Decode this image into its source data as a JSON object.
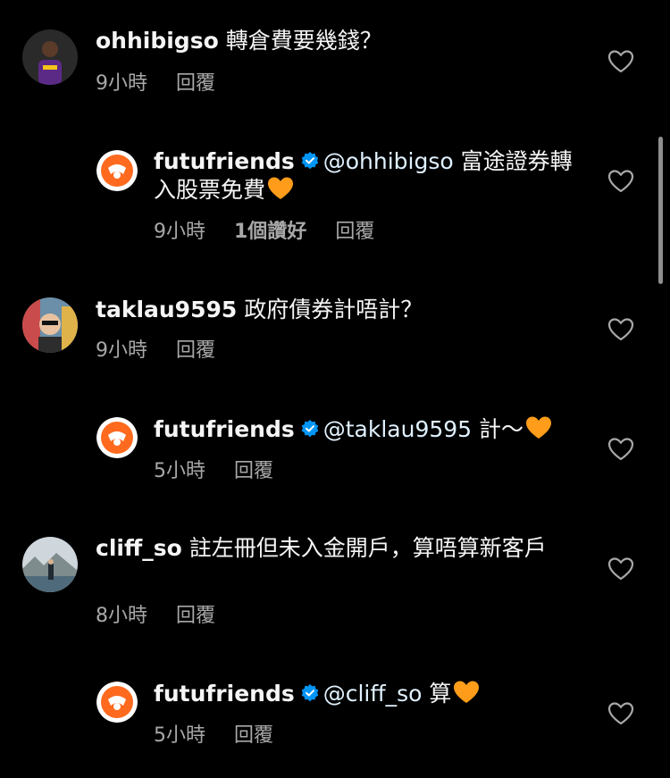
{
  "comments": [
    {
      "username": "ohhibigso",
      "text": "轉倉費要幾錢？",
      "time": "9小時",
      "reply_label": "回覆",
      "avatar": "player-photo-avatar"
    },
    {
      "username": "futufriends",
      "verified": true,
      "mention": "@ohhibigso",
      "text": "富途證券轉入股票免費",
      "emoji": "orange-heart",
      "time": "9小時",
      "likes": "1個讚好",
      "reply_label": "回覆",
      "avatar": "futu-logo-avatar"
    },
    {
      "username": "taklau9595",
      "text": "政府債券計唔計？",
      "time": "9小時",
      "reply_label": "回覆",
      "avatar": "person-photo-avatar"
    },
    {
      "username": "futufriends",
      "verified": true,
      "mention": "@taklau9595",
      "text": "計～",
      "emoji": "orange-heart",
      "time": "5小時",
      "reply_label": "回覆",
      "avatar": "futu-logo-avatar"
    },
    {
      "username": "cliff_so",
      "text": "註左冊但未入金開戶，算唔算新客戶",
      "time": "8小時",
      "reply_label": "回覆",
      "avatar": "landscape-photo-avatar"
    },
    {
      "username": "futufriends",
      "verified": true,
      "mention": "@cliff_so",
      "text": "算",
      "emoji": "orange-heart",
      "time": "5小時",
      "reply_label": "回覆",
      "avatar": "futu-logo-avatar"
    }
  ],
  "colors": {
    "background": "#000000",
    "text": "#f5f5f5",
    "meta": "#a8a8a8",
    "verified_badge": "#0095f6",
    "futu_orange": "#ff6a1f",
    "heart_emoji": "#ff9c1a"
  }
}
